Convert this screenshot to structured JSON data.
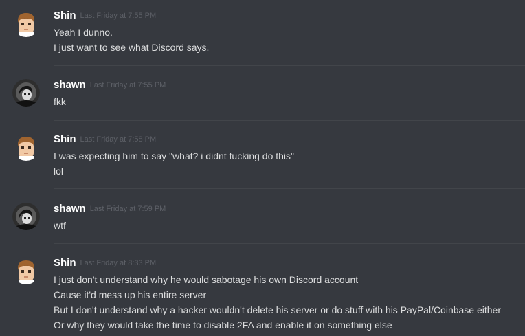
{
  "messages": [
    {
      "author": "Shin",
      "avatar": "shin-avatar-icon",
      "timestamp": "Last Friday at 7:55 PM",
      "lines": [
        "Yeah I dunno.",
        "I just want to see what Discord says."
      ]
    },
    {
      "author": "shawn",
      "avatar": "shawn-avatar-icon",
      "timestamp": "Last Friday at 7:55 PM",
      "lines": [
        "fkk"
      ]
    },
    {
      "author": "Shin",
      "avatar": "shin-avatar-icon",
      "timestamp": "Last Friday at 7:58 PM",
      "lines": [
        "I was expecting him to say \"what? i didnt fucking do this\"",
        "lol"
      ]
    },
    {
      "author": "shawn",
      "avatar": "shawn-avatar-icon",
      "timestamp": "Last Friday at 7:59 PM",
      "lines": [
        "wtf"
      ]
    },
    {
      "author": "Shin",
      "avatar": "shin-avatar-icon",
      "timestamp": "Last Friday at 8:33 PM",
      "lines": [
        "I just don't understand why he would sabotage his own Discord account",
        "Cause it'd mess up his entire server",
        "But I don't understand why a hacker wouldn't delete his server or do stuff with his PayPal/Coinbase either",
        "Or why they would take the time to disable 2FA and enable it on something else"
      ]
    }
  ],
  "colors": {
    "background": "#36393f",
    "username": "#ffffff",
    "timestamp": "#5d6067",
    "text": "#dcddde",
    "divider": "#42454a"
  }
}
